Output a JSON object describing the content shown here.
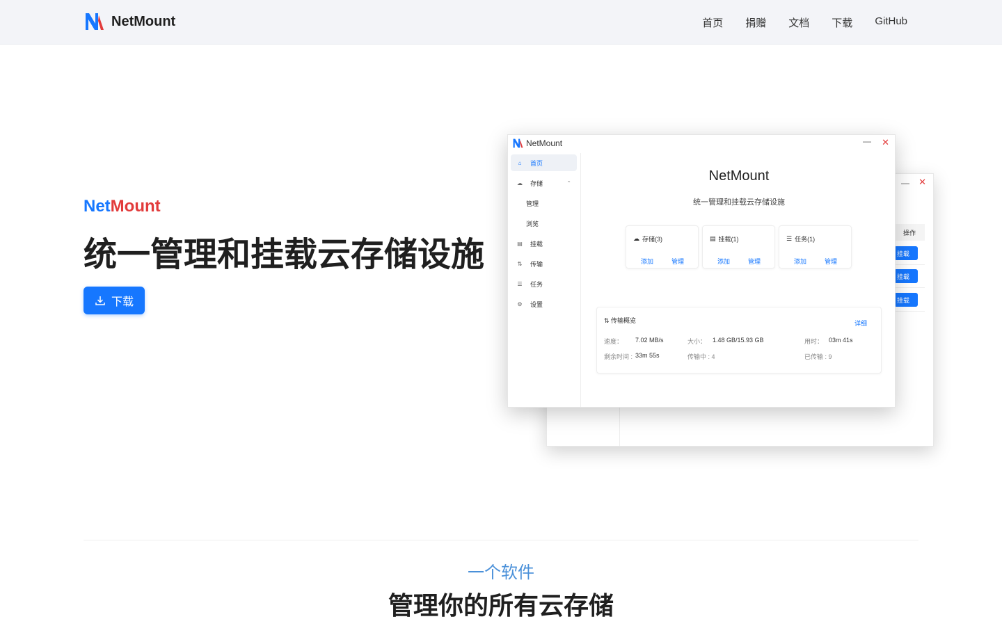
{
  "nav": {
    "brand": "NetMount",
    "links": [
      "首页",
      "捐赠",
      "文档",
      "下载",
      "GitHub"
    ]
  },
  "hero": {
    "tag_part1": "Net",
    "tag_part2": "Mount",
    "title": "统一管理和挂载云存储设施",
    "download_label": "下载"
  },
  "app_window": {
    "title": "NetMount",
    "sidebar": [
      "首页",
      "存储",
      "管理",
      "浏览",
      "挂载",
      "传输",
      "任务",
      "设置"
    ],
    "main_title": "NetMount",
    "main_subtitle": "统一管理和挂载云存储设施",
    "cards": [
      {
        "label": "存储(3)",
        "add": "添加",
        "manage": "管理"
      },
      {
        "label": "挂载(1)",
        "add": "添加",
        "manage": "管理"
      },
      {
        "label": "任务(1)",
        "add": "添加",
        "manage": "管理"
      }
    ],
    "transfer": {
      "title": "传输概览",
      "detail": "详细",
      "speed_label": "速度：",
      "speed_value": "7.02 MB/s",
      "size_label": "大小：",
      "size_value": "1.48 GB/15.93 GB",
      "elapsed_label": "用时：",
      "elapsed_value": "03m 41s",
      "remaining_label": "剩余时间 :",
      "remaining_value": "33m 55s",
      "transferring_label": "传输中 : 4",
      "transferred_label": "已传输 : 9"
    }
  },
  "back_window": {
    "col_header": "操作",
    "row_button": "挂载"
  },
  "section": {
    "kicker": "一个软件",
    "title": "管理你的所有云存储"
  },
  "colors": {
    "accent": "#1677ff",
    "brand_red": "#e23b3b"
  }
}
